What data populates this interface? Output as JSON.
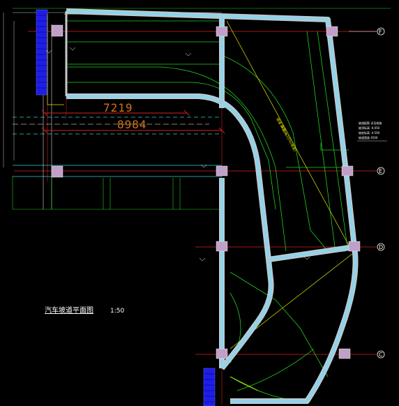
{
  "drawing": {
    "title": "汽车坡道平面图",
    "title_suffix": "1:50",
    "dim_inner": "7219",
    "dim_outer": "8984",
    "axis_labels": [
      "F",
      "E",
      "D",
      "C"
    ],
    "yellow_note_1": "坡道 i=15%",
    "yellow_note_2": "坡道 i=15%(坡道)",
    "side_note_lines": [
      "坡道配筋 详见结施",
      "坡顶标高 -0.050",
      "坡底标高 -4.500",
      "坡道宽度 4500"
    ]
  },
  "colors": {
    "background": "#000000",
    "wall_fill": "#8fd3ea",
    "wall_edge": "#c8c8c8",
    "green": "#1ed21e",
    "red": "#e01e1e",
    "yellow": "#e6e600",
    "cyan": "#3cc8c8",
    "blue": "#1e1ee6",
    "column": "#c0a0c8"
  }
}
